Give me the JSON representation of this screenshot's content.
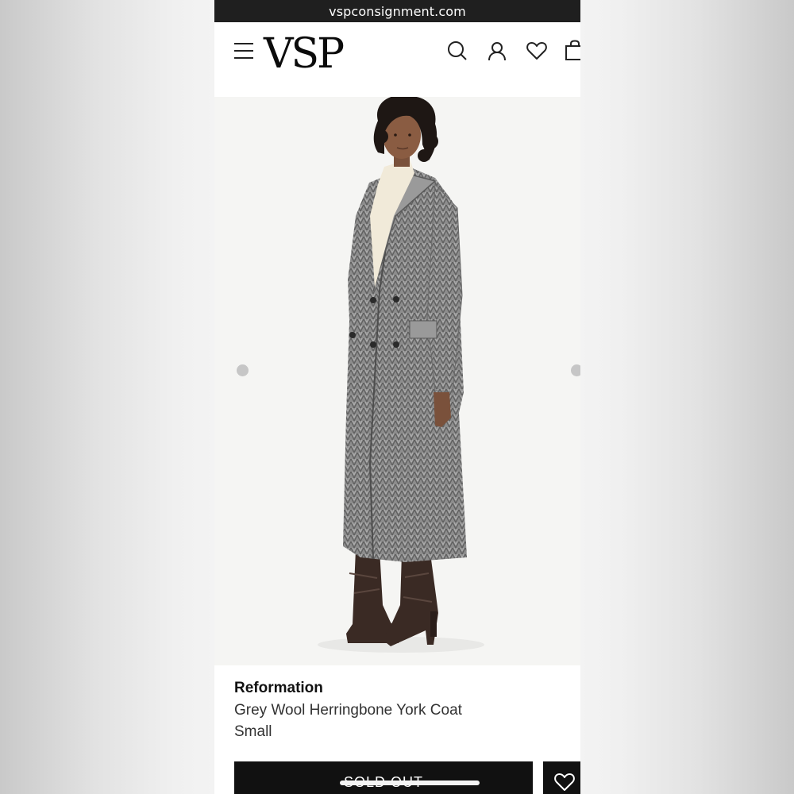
{
  "browser": {
    "url": "vspconsignment.com"
  },
  "header": {
    "logo": "VSP",
    "icons": [
      "menu-icon",
      "search-icon",
      "account-icon",
      "heart-icon",
      "bag-icon"
    ]
  },
  "product": {
    "brand": "Reformation",
    "name": "Grey Wool Herringbone York Coat",
    "size": "Small",
    "button_label": "SOLD OUT"
  },
  "colors": {
    "url_bar": "#1f1f1f",
    "button": "#111111",
    "photo_background": "#f5f5f3",
    "coat": "#8c8c8c",
    "carousel_dot": "#c6c6c6"
  }
}
